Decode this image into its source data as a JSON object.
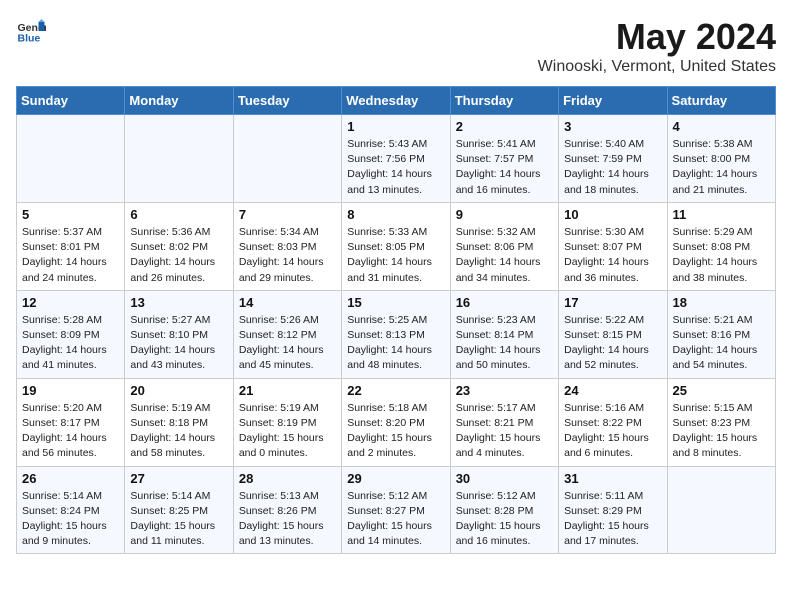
{
  "header": {
    "logo_general": "General",
    "logo_blue": "Blue",
    "title": "May 2024",
    "subtitle": "Winooski, Vermont, United States"
  },
  "weekdays": [
    "Sunday",
    "Monday",
    "Tuesday",
    "Wednesday",
    "Thursday",
    "Friday",
    "Saturday"
  ],
  "weeks": [
    [
      {
        "num": "",
        "info": ""
      },
      {
        "num": "",
        "info": ""
      },
      {
        "num": "",
        "info": ""
      },
      {
        "num": "1",
        "info": "Sunrise: 5:43 AM\nSunset: 7:56 PM\nDaylight: 14 hours\nand 13 minutes."
      },
      {
        "num": "2",
        "info": "Sunrise: 5:41 AM\nSunset: 7:57 PM\nDaylight: 14 hours\nand 16 minutes."
      },
      {
        "num": "3",
        "info": "Sunrise: 5:40 AM\nSunset: 7:59 PM\nDaylight: 14 hours\nand 18 minutes."
      },
      {
        "num": "4",
        "info": "Sunrise: 5:38 AM\nSunset: 8:00 PM\nDaylight: 14 hours\nand 21 minutes."
      }
    ],
    [
      {
        "num": "5",
        "info": "Sunrise: 5:37 AM\nSunset: 8:01 PM\nDaylight: 14 hours\nand 24 minutes."
      },
      {
        "num": "6",
        "info": "Sunrise: 5:36 AM\nSunset: 8:02 PM\nDaylight: 14 hours\nand 26 minutes."
      },
      {
        "num": "7",
        "info": "Sunrise: 5:34 AM\nSunset: 8:03 PM\nDaylight: 14 hours\nand 29 minutes."
      },
      {
        "num": "8",
        "info": "Sunrise: 5:33 AM\nSunset: 8:05 PM\nDaylight: 14 hours\nand 31 minutes."
      },
      {
        "num": "9",
        "info": "Sunrise: 5:32 AM\nSunset: 8:06 PM\nDaylight: 14 hours\nand 34 minutes."
      },
      {
        "num": "10",
        "info": "Sunrise: 5:30 AM\nSunset: 8:07 PM\nDaylight: 14 hours\nand 36 minutes."
      },
      {
        "num": "11",
        "info": "Sunrise: 5:29 AM\nSunset: 8:08 PM\nDaylight: 14 hours\nand 38 minutes."
      }
    ],
    [
      {
        "num": "12",
        "info": "Sunrise: 5:28 AM\nSunset: 8:09 PM\nDaylight: 14 hours\nand 41 minutes."
      },
      {
        "num": "13",
        "info": "Sunrise: 5:27 AM\nSunset: 8:10 PM\nDaylight: 14 hours\nand 43 minutes."
      },
      {
        "num": "14",
        "info": "Sunrise: 5:26 AM\nSunset: 8:12 PM\nDaylight: 14 hours\nand 45 minutes."
      },
      {
        "num": "15",
        "info": "Sunrise: 5:25 AM\nSunset: 8:13 PM\nDaylight: 14 hours\nand 48 minutes."
      },
      {
        "num": "16",
        "info": "Sunrise: 5:23 AM\nSunset: 8:14 PM\nDaylight: 14 hours\nand 50 minutes."
      },
      {
        "num": "17",
        "info": "Sunrise: 5:22 AM\nSunset: 8:15 PM\nDaylight: 14 hours\nand 52 minutes."
      },
      {
        "num": "18",
        "info": "Sunrise: 5:21 AM\nSunset: 8:16 PM\nDaylight: 14 hours\nand 54 minutes."
      }
    ],
    [
      {
        "num": "19",
        "info": "Sunrise: 5:20 AM\nSunset: 8:17 PM\nDaylight: 14 hours\nand 56 minutes."
      },
      {
        "num": "20",
        "info": "Sunrise: 5:19 AM\nSunset: 8:18 PM\nDaylight: 14 hours\nand 58 minutes."
      },
      {
        "num": "21",
        "info": "Sunrise: 5:19 AM\nSunset: 8:19 PM\nDaylight: 15 hours\nand 0 minutes."
      },
      {
        "num": "22",
        "info": "Sunrise: 5:18 AM\nSunset: 8:20 PM\nDaylight: 15 hours\nand 2 minutes."
      },
      {
        "num": "23",
        "info": "Sunrise: 5:17 AM\nSunset: 8:21 PM\nDaylight: 15 hours\nand 4 minutes."
      },
      {
        "num": "24",
        "info": "Sunrise: 5:16 AM\nSunset: 8:22 PM\nDaylight: 15 hours\nand 6 minutes."
      },
      {
        "num": "25",
        "info": "Sunrise: 5:15 AM\nSunset: 8:23 PM\nDaylight: 15 hours\nand 8 minutes."
      }
    ],
    [
      {
        "num": "26",
        "info": "Sunrise: 5:14 AM\nSunset: 8:24 PM\nDaylight: 15 hours\nand 9 minutes."
      },
      {
        "num": "27",
        "info": "Sunrise: 5:14 AM\nSunset: 8:25 PM\nDaylight: 15 hours\nand 11 minutes."
      },
      {
        "num": "28",
        "info": "Sunrise: 5:13 AM\nSunset: 8:26 PM\nDaylight: 15 hours\nand 13 minutes."
      },
      {
        "num": "29",
        "info": "Sunrise: 5:12 AM\nSunset: 8:27 PM\nDaylight: 15 hours\nand 14 minutes."
      },
      {
        "num": "30",
        "info": "Sunrise: 5:12 AM\nSunset: 8:28 PM\nDaylight: 15 hours\nand 16 minutes."
      },
      {
        "num": "31",
        "info": "Sunrise: 5:11 AM\nSunset: 8:29 PM\nDaylight: 15 hours\nand 17 minutes."
      },
      {
        "num": "",
        "info": ""
      }
    ]
  ]
}
